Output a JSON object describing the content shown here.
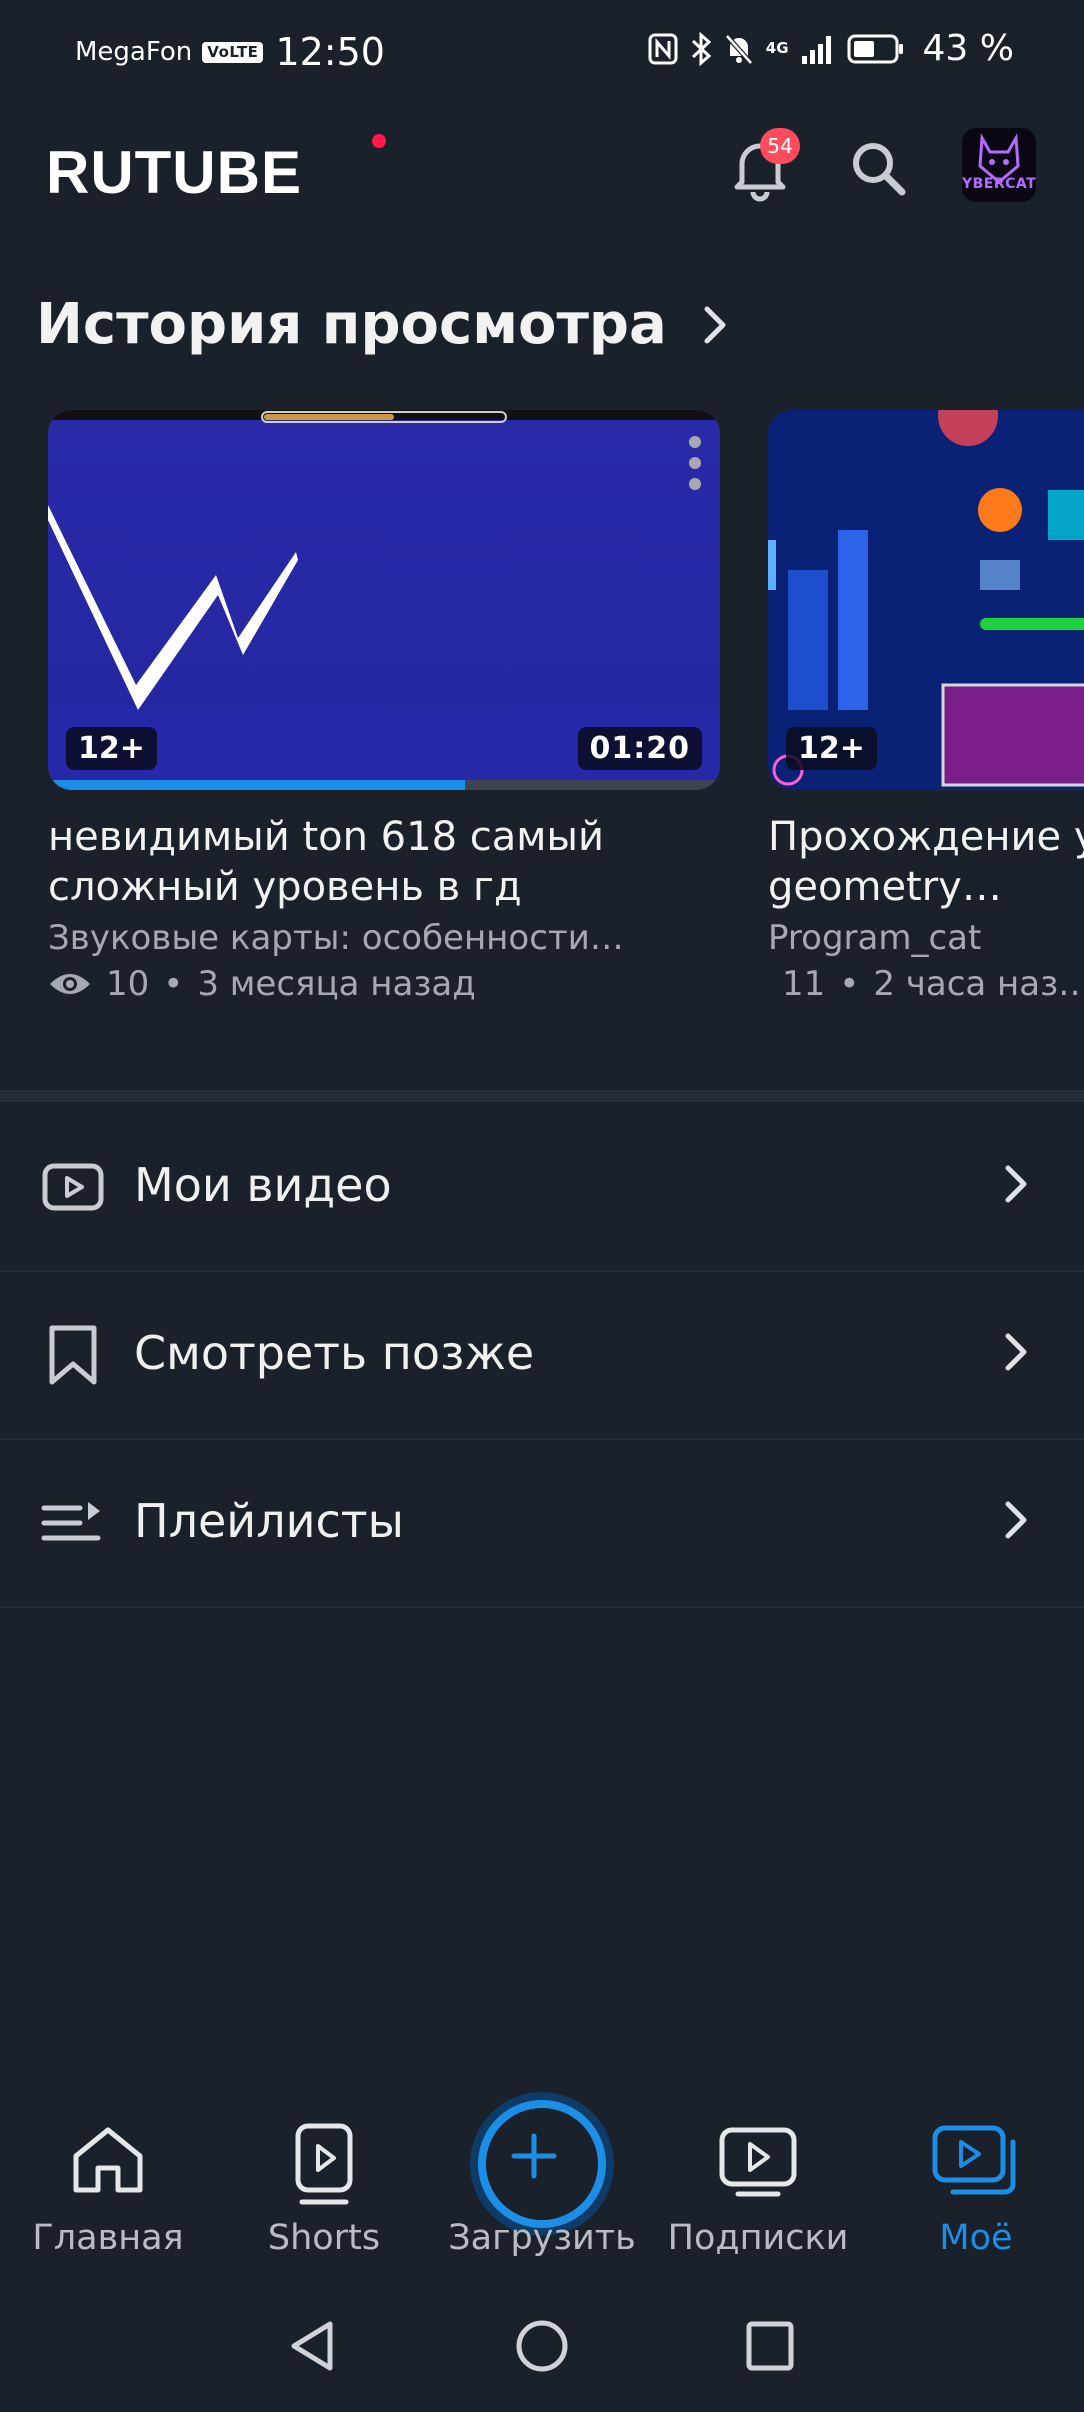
{
  "status_bar": {
    "carrier": "MegaFon",
    "volte": "VoLTE",
    "time": "12:50",
    "network": "4G",
    "battery": "43 %"
  },
  "header": {
    "logo": "RUTUBE",
    "notifications_count": "54",
    "avatar_text": "YBERCAT"
  },
  "history": {
    "title": "История просмотра",
    "cards": [
      {
        "age": "12+",
        "duration": "01:20",
        "progress": 0.62,
        "title": "невидимый ton 618 самый сложный уровень в гд",
        "channel": "Звуковые карты: особенности…",
        "views": "10",
        "time_ago": "3 месяца назад"
      },
      {
        "age": "12+",
        "title": "Прохождение ур… race в geometry…",
        "channel": "Program_cat",
        "views": "11",
        "time_ago": "2 часа наз…"
      }
    ],
    "meta_separator": "•"
  },
  "menu": {
    "my_videos": "Мои видео",
    "watch_later": "Смотреть позже",
    "playlists": "Плейлисты"
  },
  "bottom_nav": {
    "home": "Главная",
    "shorts": "Shorts",
    "upload": "Загрузить",
    "subscriptions": "Подписки",
    "mine": "Моё"
  },
  "colors": {
    "background": "#1b212b",
    "accent": "#1c8ee6",
    "badge": "#ff4d5e",
    "logo_dot": "#ff1a4a"
  }
}
